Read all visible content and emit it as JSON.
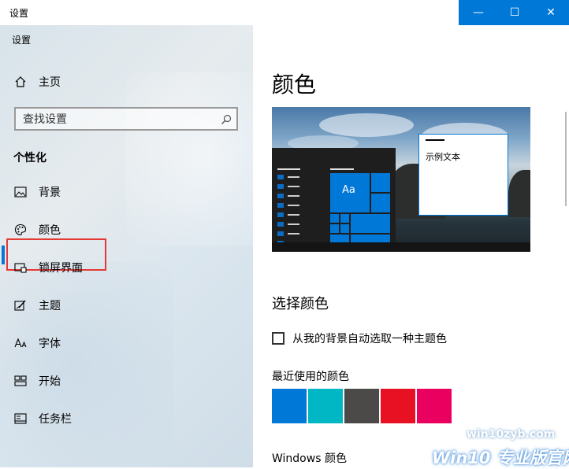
{
  "window": {
    "title": "设置",
    "buttons": {
      "minimize": "—",
      "maximize": "☐",
      "close": "✕"
    },
    "accent": "#0078d7"
  },
  "sidebar": {
    "app_label": "设置",
    "home_label": "主页",
    "search_placeholder": "查找设置",
    "section_label": "个性化",
    "items": [
      {
        "label": "背景",
        "icon": "picture-icon"
      },
      {
        "label": "颜色",
        "icon": "palette-icon",
        "selected": true
      },
      {
        "label": "锁屏界面",
        "icon": "lock-screen-icon"
      },
      {
        "label": "主题",
        "icon": "theme-icon"
      },
      {
        "label": "字体",
        "icon": "font-icon"
      },
      {
        "label": "开始",
        "icon": "start-icon"
      },
      {
        "label": "任务栏",
        "icon": "taskbar-icon"
      }
    ]
  },
  "main": {
    "title": "颜色",
    "preview": {
      "sample_text": "示例文本",
      "tile_text": "Aa"
    },
    "choose_color_heading": "选择颜色",
    "auto_pick_label": "从我的背景自动选取一种主题色",
    "auto_pick_checked": false,
    "recent_colors_label": "最近使用的颜色",
    "recent_colors": [
      "#0078d7",
      "#00b7c3",
      "#4c4a48",
      "#e81123",
      "#ea005e"
    ],
    "windows_colors_label": "Windows 颜色"
  },
  "watermark": {
    "line1": "win10zyb.com",
    "line2": "Win10 专业版官网"
  }
}
